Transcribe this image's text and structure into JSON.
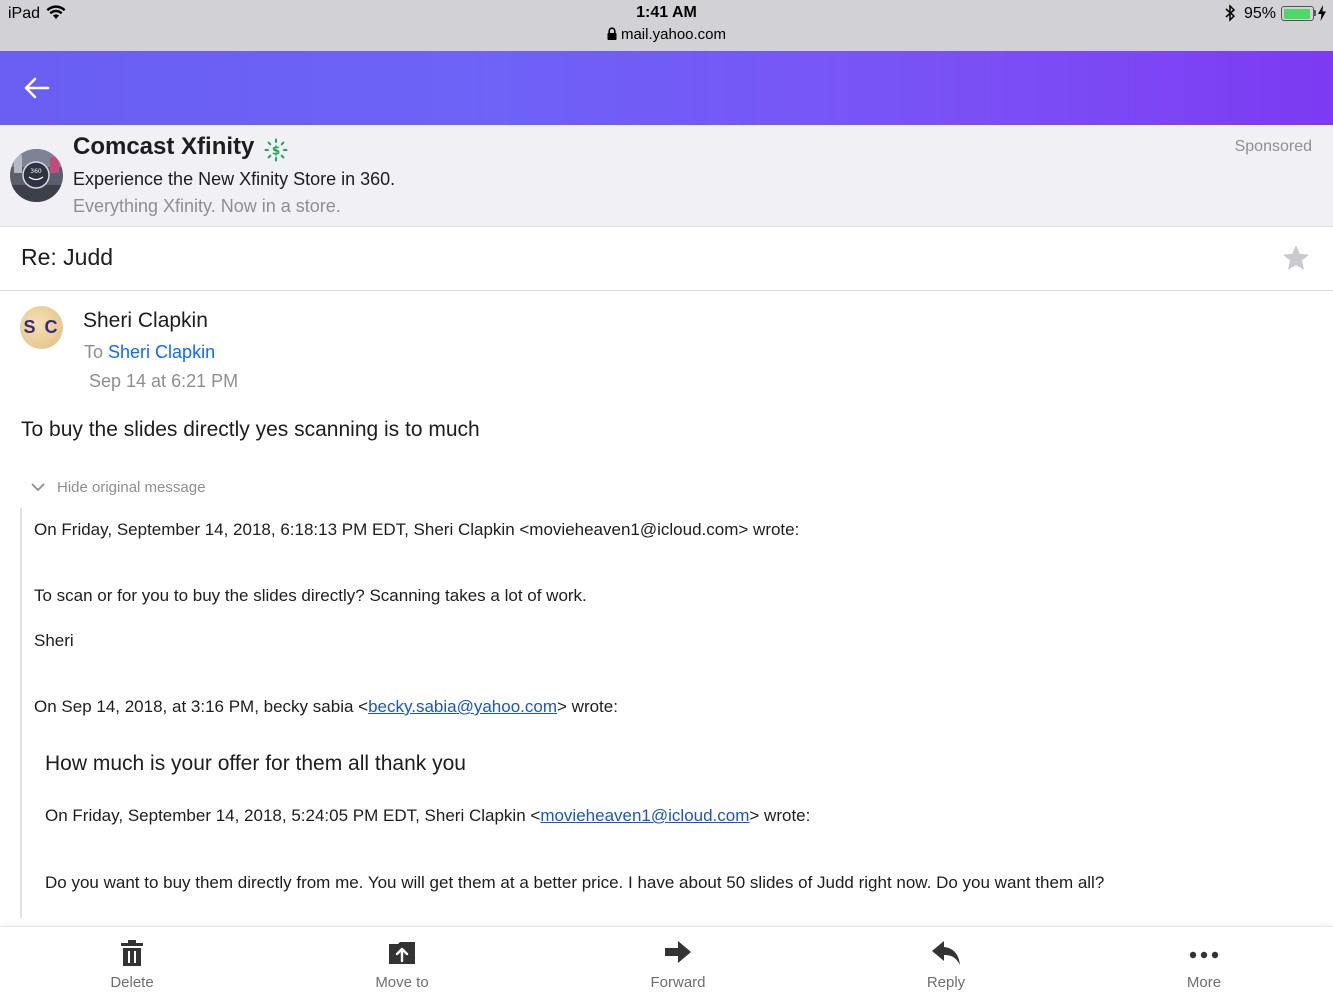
{
  "status_bar": {
    "device": "iPad",
    "time": "1:41 AM",
    "url": "mail.yahoo.com",
    "battery_percent": "95%",
    "battery_level": 0.95,
    "battery_color": "#4cd964"
  },
  "header": {
    "back_icon": "arrow-left-icon",
    "gradient": [
      "#6a5ef2",
      "#7c3af2"
    ]
  },
  "ad": {
    "advertiser": "Comcast Xfinity",
    "headline": "Experience the New Xfinity Store in 360.",
    "tagline": "Everything Xfinity. Now in a store.",
    "sponsored_label": "Sponsored",
    "sponsored_icon": "dollar-sun-icon",
    "logo_text": "360"
  },
  "email": {
    "subject": "Re: Judd",
    "star_icon": "star-icon",
    "sender": {
      "initials": "S C",
      "name": "Sheri Clapkin",
      "to_prefix": "To",
      "to_name": "Sheri Clapkin",
      "date": "Sep 14 at 6:21 PM"
    },
    "body": "To buy the slides directly yes scanning is to much",
    "hide_original_label": "Hide original message",
    "quoted": {
      "header1": "On Friday, September 14, 2018, 6:18:13 PM EDT, Sheri Clapkin <movieheaven1@icloud.com> wrote:",
      "line1": "To scan or for you to buy the slides directly? Scanning takes a lot of work.",
      "signature": "Sheri",
      "header2_prefix": "On Sep 14, 2018, at 3:16 PM, becky sabia <",
      "header2_email": "becky.sabia@yahoo.com",
      "header2_suffix": "> wrote:",
      "line2": "How much is your offer for them all thank you",
      "header3_prefix": "On Friday, September 14, 2018, 5:24:05 PM EDT, Sheri Clapkin <",
      "header3_email": "movieheaven1@icloud.com",
      "header3_suffix": "> wrote:",
      "line3": "Do you want to buy them directly from me. You will get them at a better price. I have about 50 slides of Judd right now. Do you want them all?"
    }
  },
  "toolbar": {
    "delete_label": "Delete",
    "move_label": "Move to",
    "forward_label": "Forward",
    "reply_label": "Reply",
    "more_label": "More"
  }
}
